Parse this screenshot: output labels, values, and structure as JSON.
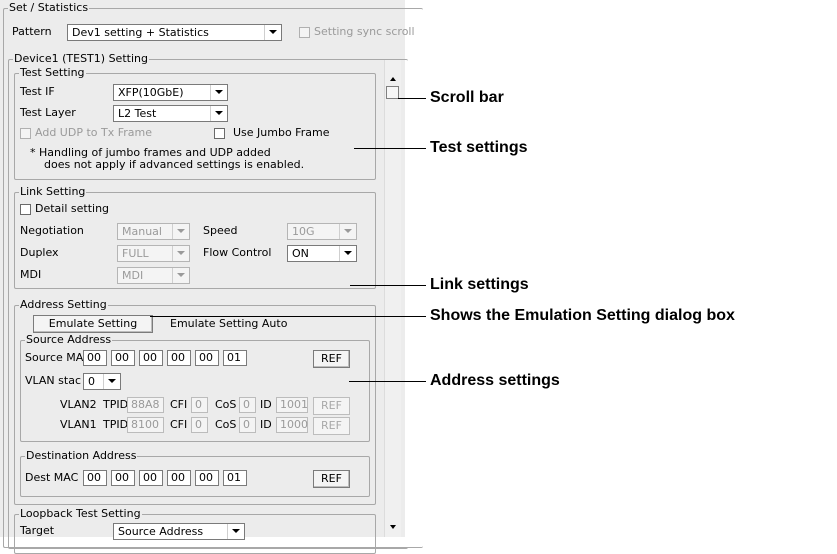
{
  "set_stats": {
    "title": "Set / Statistics",
    "pattern_label": "Pattern",
    "pattern_value": "Dev1 setting + Statistics",
    "sync_scroll_label": "Setting sync scroll"
  },
  "device": {
    "title": "Device1 (TEST1) Setting"
  },
  "test_setting": {
    "title": "Test Setting",
    "test_if_label": "Test IF",
    "test_if_value": "XFP(10GbE)",
    "test_layer_label": "Test Layer",
    "test_layer_value": "L2 Test",
    "add_udp_label": "Add UDP to Tx Frame",
    "jumbo_label": "Use Jumbo Frame",
    "note_line1": "* Handling of jumbo frames and UDP added",
    "note_line2": "does not apply if advanced settings is enabled."
  },
  "link_setting": {
    "title": "Link Setting",
    "detail_label": "Detail setting",
    "negotiation_label": "Negotiation",
    "negotiation_value": "Manual",
    "speed_label": "Speed",
    "speed_value": "10G",
    "duplex_label": "Duplex",
    "duplex_value": "FULL",
    "flow_label": "Flow Control",
    "flow_value": "ON",
    "mdi_label": "MDI",
    "mdi_value": "MDI"
  },
  "address_setting": {
    "title": "Address Setting",
    "emulate_button": "Emulate Setting",
    "emulate_auto": "Emulate Setting Auto",
    "source": {
      "title": "Source Address",
      "mac_label": "Source MAC",
      "mac": [
        "00",
        "00",
        "00",
        "00",
        "00",
        "01"
      ],
      "ref": "REF",
      "vlan_stack_label": "VLAN stac",
      "vlan_stack_value": "0",
      "vlan2": {
        "label": "VLAN2",
        "tpid_label": "TPID",
        "tpid": "88A8",
        "cfi_label": "CFI",
        "cfi": "0",
        "cos_label": "CoS",
        "cos": "0",
        "id_label": "ID",
        "id": "1001",
        "ref": "REF"
      },
      "vlan1": {
        "label": "VLAN1",
        "tpid_label": "TPID",
        "tpid": "8100",
        "cfi_label": "CFI",
        "cfi": "0",
        "cos_label": "CoS",
        "cos": "0",
        "id_label": "ID",
        "id": "1000",
        "ref": "REF"
      }
    },
    "destination": {
      "title": "Destination Address",
      "mac_label": "Dest MAC",
      "mac": [
        "00",
        "00",
        "00",
        "00",
        "00",
        "01"
      ],
      "ref": "REF"
    }
  },
  "loopback": {
    "title": "Loopback Test Setting",
    "target_label": "Target",
    "target_value": "Source Address"
  },
  "annotations": {
    "scroll_bar": "Scroll bar",
    "test_settings": "Test settings",
    "link_settings": "Link settings",
    "emulation": "Shows the Emulation Setting dialog box",
    "address_settings": "Address settings"
  }
}
